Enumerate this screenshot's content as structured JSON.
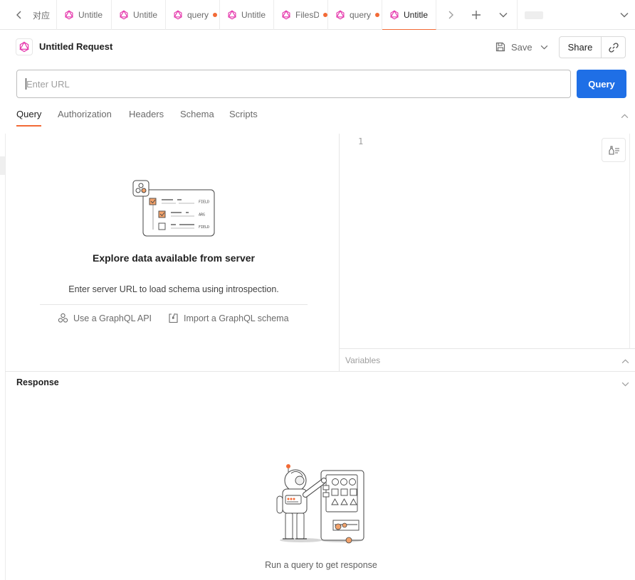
{
  "tabbar": {
    "tabs": [
      {
        "label": "对应",
        "has_icon": false,
        "modified": false,
        "active": false
      },
      {
        "label": "Untitle",
        "has_icon": true,
        "modified": false,
        "active": false
      },
      {
        "label": "Untitle",
        "has_icon": true,
        "modified": false,
        "active": false
      },
      {
        "label": "query",
        "has_icon": true,
        "modified": true,
        "active": false
      },
      {
        "label": "Untitle",
        "has_icon": true,
        "modified": false,
        "active": false
      },
      {
        "label": "FilesD",
        "has_icon": true,
        "modified": true,
        "active": false
      },
      {
        "label": "query",
        "has_icon": true,
        "modified": true,
        "active": false
      },
      {
        "label": "Untitle",
        "has_icon": true,
        "modified": false,
        "active": true
      }
    ],
    "icons": {
      "prev": "chevron-left-icon",
      "next": "chevron-right-icon",
      "add": "plus-icon",
      "menu": "chevron-down-icon"
    }
  },
  "header": {
    "title": "Untitled Request",
    "save_label": "Save",
    "share_label": "Share"
  },
  "url": {
    "value": "",
    "placeholder": "Enter URL"
  },
  "query_button": "Query",
  "subtabs": [
    "Query",
    "Authorization",
    "Headers",
    "Schema",
    "Scripts"
  ],
  "active_subtab": "Query",
  "editor": {
    "line_number": "1",
    "variables_label": "Variables"
  },
  "explore": {
    "title": "Explore data available from server",
    "description": "Enter server URL to load schema using introspection.",
    "use_api_label": "Use a GraphQL API",
    "import_label": "Import a GraphQL schema",
    "illus_field_1": "FIELD",
    "illus_field_2": "ARG",
    "illus_field_3": "FIELD"
  },
  "response": {
    "title": "Response",
    "empty_text": "Run a query to get response"
  },
  "colors": {
    "accent": "#f26a36",
    "primary": "#1f6fe6",
    "graphql": "#e535ab"
  }
}
